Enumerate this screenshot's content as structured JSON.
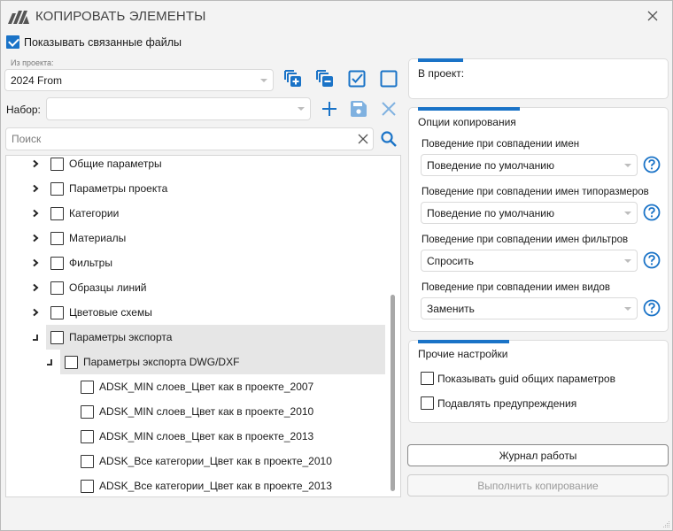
{
  "window": {
    "title": "КОПИРОВАТЬ ЭЛЕМЕНТЫ",
    "close_icon": "close-icon",
    "logo_icon": "app-logo-icon"
  },
  "left": {
    "show_linked": {
      "label": "Показывать связанные файлы",
      "checked": true
    },
    "from_project": {
      "label": "Из проекта:",
      "value": "2024 From"
    },
    "toolbar_icons": [
      "add-copy-icon",
      "remove-copy-icon",
      "check-all-icon",
      "uncheck-all-icon"
    ],
    "set": {
      "label": "Набор:",
      "value": ""
    },
    "set_icons": [
      "plus-icon",
      "save-icon",
      "delete-icon"
    ],
    "search": {
      "placeholder": "Поиск",
      "value": ""
    },
    "tree": [
      {
        "label": "Общие параметры",
        "level": 0,
        "expander": "collapsed",
        "checked": false
      },
      {
        "label": "Параметры проекта",
        "level": 0,
        "expander": "collapsed",
        "checked": false
      },
      {
        "label": "Категории",
        "level": 0,
        "expander": "collapsed",
        "checked": false
      },
      {
        "label": "Материалы",
        "level": 0,
        "expander": "collapsed",
        "checked": false
      },
      {
        "label": "Фильтры",
        "level": 0,
        "expander": "collapsed",
        "checked": false
      },
      {
        "label": "Образцы линий",
        "level": 0,
        "expander": "collapsed",
        "checked": false
      },
      {
        "label": "Цветовые схемы",
        "level": 0,
        "expander": "collapsed",
        "checked": false
      },
      {
        "label": "Параметры экспорта",
        "level": 0,
        "expander": "expanded",
        "checked": false,
        "highlighted": true
      },
      {
        "label": "Параметры экспорта DWG/DXF",
        "level": 1,
        "expander": "expanded",
        "checked": false,
        "highlighted": true
      },
      {
        "label": "ADSK_MIN слоев_Цвет как в проекте_2007",
        "level": 2,
        "expander": "none",
        "checked": false
      },
      {
        "label": "ADSK_MIN слоев_Цвет как в проекте_2010",
        "level": 2,
        "expander": "none",
        "checked": false
      },
      {
        "label": "ADSK_MIN слоев_Цвет как в проекте_2013",
        "level": 2,
        "expander": "none",
        "checked": false
      },
      {
        "label": "ADSK_Все категории_Цвет как в проекте_2010",
        "level": 2,
        "expander": "none",
        "checked": false
      },
      {
        "label": "ADSK_Все категории_Цвет как в проекте_2013",
        "level": 2,
        "expander": "none",
        "checked": false
      }
    ]
  },
  "right": {
    "to_project": {
      "label": "В проект:",
      "value": ""
    },
    "copy_options": {
      "title": "Опции копирования",
      "options": [
        {
          "label": "Поведение при совпадении имен",
          "value": "Поведение по умолчанию"
        },
        {
          "label": "Поведение при совпадении имен типоразмеров",
          "value": "Поведение по умолчанию"
        },
        {
          "label": "Поведение при совпадении имен фильтров",
          "value": "Спросить"
        },
        {
          "label": "Поведение при совпадении имен видов",
          "value": "Заменить"
        }
      ]
    },
    "other_settings": {
      "title": "Прочие настройки",
      "items": [
        {
          "label": "Показывать guid общих параметров",
          "checked": false
        },
        {
          "label": "Подавлять предупреждения",
          "checked": false
        }
      ]
    },
    "buttons": {
      "log": "Журнал работы",
      "execute": "Выполнить копирование"
    }
  },
  "colors": {
    "accent": "#1a73c7",
    "disabled_icon": "#7fb1e0",
    "highlight_row": "#e6e6e6"
  }
}
